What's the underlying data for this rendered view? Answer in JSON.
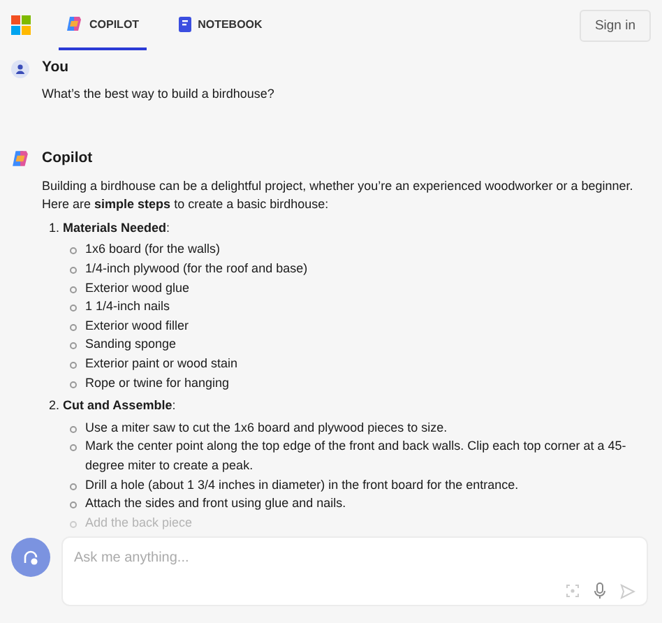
{
  "header": {
    "tabs": [
      {
        "label": "COPILOT",
        "kind": "copilot",
        "selected": true
      },
      {
        "label": "NOTEBOOK",
        "kind": "notebook",
        "selected": false
      }
    ],
    "sign_in": "Sign in"
  },
  "messages": [
    {
      "kind": "user",
      "author": "You",
      "text": "What’s the best way to build a birdhouse?"
    },
    {
      "kind": "copilot",
      "author": "Copilot",
      "intro": "Building a birdhouse can be a delightful project, whether you’re an experienced woodworker or a beginner. Here are **simple steps** to create a basic birdhouse:",
      "sections": [
        {
          "title": "1. **Materials Needed**:",
          "items": [
            {
              "text": "1x6 board (for the walls)",
              "faded": false
            },
            {
              "text": "1/4-inch plywood (for the roof and base)",
              "faded": false
            },
            {
              "text": "Exterior wood glue",
              "faded": false
            },
            {
              "text": "1 1/4-inch nails",
              "faded": false
            },
            {
              "text": "Exterior wood filler",
              "faded": false
            },
            {
              "text": "Sanding sponge",
              "faded": false
            },
            {
              "text": "Exterior paint or wood stain",
              "faded": false
            },
            {
              "text": "Rope or twine for hanging",
              "faded": false
            }
          ]
        },
        {
          "title": "2. **Cut and Assemble**:",
          "items": [
            {
              "text": "Use a miter saw to cut the 1x6 board and plywood pieces to size.",
              "faded": false
            },
            {
              "text": "Mark the center point along the top edge of the front and back walls. Clip each top corner at a 45-degree miter to create a peak.",
              "faded": false
            },
            {
              "text": "Drill a hole (about 1 3/4 inches in diameter) in the front board for the entrance.",
              "faded": false
            },
            {
              "text": "Attach the sides and front using glue and nails.",
              "faded": false
            },
            {
              "text": "Add the back piece",
              "faded": true
            }
          ]
        }
      ]
    }
  ],
  "composer": {
    "placeholder": "Ask me anything..."
  }
}
